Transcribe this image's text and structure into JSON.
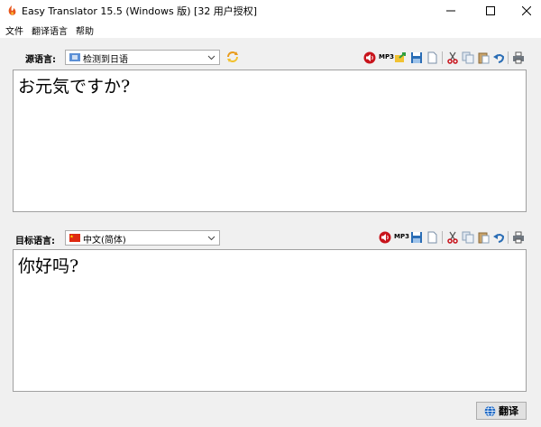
{
  "window": {
    "title": "Easy Translator 15.5 (Windows 版) [32 用户授权]"
  },
  "menu": {
    "items": [
      "文件",
      "翻译语言",
      "帮助"
    ]
  },
  "source": {
    "label": "源语言:",
    "language": "检测到日语",
    "text": "お元気ですか?",
    "mp3_label": "MP3"
  },
  "target": {
    "label": "目标语言:",
    "language": "中文(简体)",
    "text": "你好吗?",
    "mp3_label": "MP3"
  },
  "actions": {
    "translate_label": "翻译"
  },
  "colors": {
    "accent": "#1a66c4",
    "flag_cn": "#de2910",
    "flag_jp_box": "#5b8fd6"
  },
  "icons": {
    "speaker": "speaker-icon",
    "export": "export-icon",
    "save": "save-icon",
    "new": "new-document-icon",
    "cut": "cut-icon",
    "copy": "copy-icon",
    "paste": "paste-icon",
    "undo": "undo-icon",
    "print": "print-icon",
    "globe": "globe-icon"
  }
}
